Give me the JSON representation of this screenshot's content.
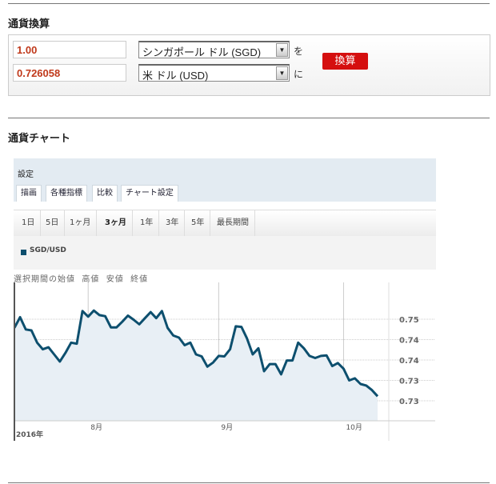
{
  "converter": {
    "title": "通貨換算",
    "amount": "1.00",
    "result": "0.726058",
    "from_currency": "シンガポール ドル (SGD)",
    "to_currency": "米 ドル (USD)",
    "from_particle": "を",
    "to_particle": "に",
    "convert_label": "換算"
  },
  "chart_section": {
    "title": "通貨チャート",
    "settings_label": "設定",
    "tabs": [
      "描画",
      "各種指標",
      "比較",
      "チャート設定"
    ],
    "ranges": [
      "1日",
      "5日",
      "1ヶ月",
      "3ヶ月",
      "1年",
      "3年",
      "5年",
      "最長期間"
    ],
    "active_range": "3ヶ月",
    "legend": "SGD/USD",
    "legend_color": "#0d4f6e",
    "stats": [
      "選択期間の始値",
      "高値",
      "安値",
      "終値"
    ]
  },
  "chart_data": {
    "type": "area",
    "series": [
      {
        "name": "SGD/USD",
        "values": [
          0.7463,
          0.7484,
          0.746,
          0.7458,
          0.7434,
          0.7421,
          0.7425,
          0.7411,
          0.7397,
          0.7414,
          0.7434,
          0.7432,
          0.7496,
          0.7485,
          0.7497,
          0.7488,
          0.7486,
          0.7464,
          0.7464,
          0.7475,
          0.7487,
          0.7479,
          0.747,
          0.7482,
          0.7494,
          0.7482,
          0.7496,
          0.7463,
          0.7448,
          0.7444,
          0.7429,
          0.7434,
          0.7411,
          0.7407,
          0.7387,
          0.7395,
          0.7408,
          0.7407,
          0.7421,
          0.7466,
          0.7465,
          0.7442,
          0.7411,
          0.7423,
          0.7378,
          0.7392,
          0.7392,
          0.7372,
          0.7399,
          0.7399,
          0.7434,
          0.7423,
          0.7408,
          0.7404,
          0.7408,
          0.7409,
          0.7388,
          0.7394,
          0.7383,
          0.736,
          0.7364,
          0.7353,
          0.735,
          0.7341,
          0.7329
        ]
      }
    ],
    "y_ticks": [
      0.748,
      0.744,
      0.74,
      0.736,
      0.732
    ],
    "y_tick_labels": [
      "0.75",
      "0.74",
      "0.74",
      "0.73",
      "0.73"
    ],
    "x_ticks": [
      {
        "label": "8月",
        "index": 13
      },
      {
        "label": "9月",
        "index": 36
      },
      {
        "label": "10月",
        "index": 58
      }
    ],
    "year_label": "2016年",
    "grid": true
  }
}
